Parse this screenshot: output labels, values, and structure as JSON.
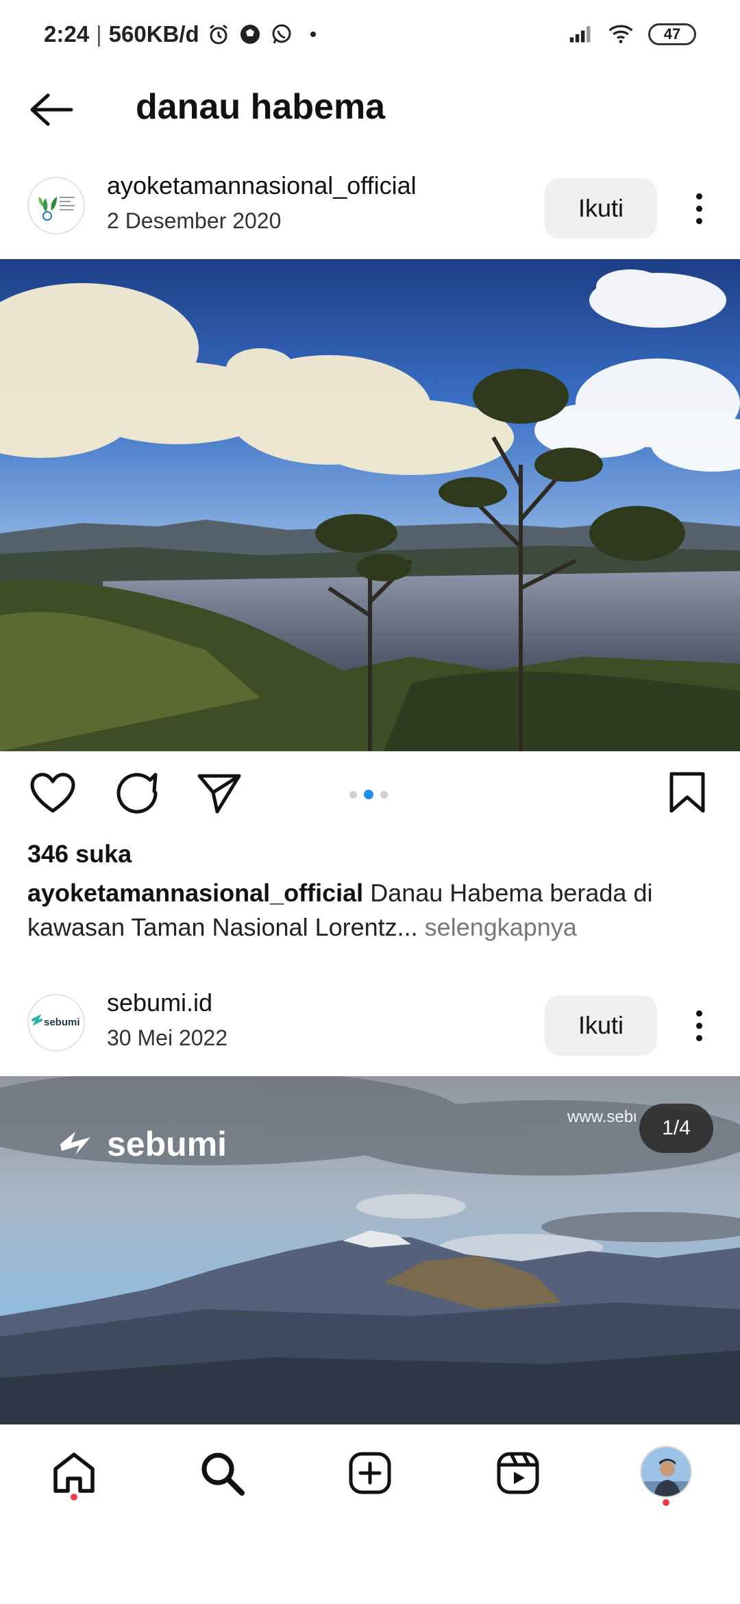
{
  "status_bar": {
    "time": "2:24",
    "separator": "|",
    "network_speed": "560KB/d",
    "battery": "47",
    "icons": [
      "alarm-icon",
      "soccer-ball-icon",
      "whatsapp-icon",
      "dot-icon",
      "signal-icon",
      "wifi-icon",
      "battery-icon"
    ]
  },
  "header": {
    "title": "danau habema",
    "back_icon": "arrow-left-icon"
  },
  "posts": [
    {
      "username": "ayoketamannasional_official",
      "date": "2 Desember 2020",
      "follow_label": "Ikuti",
      "avatar_text": "ayo ke taman nasional",
      "likes": "346 suka",
      "caption_user": "ayoketamannasional_official",
      "caption_text": " Danau Habema berada di kawasan Taman Nasional Lorentz",
      "caption_ellipsis": "...",
      "caption_more": " selengkapnya",
      "carousel_total": 3,
      "carousel_active": 1
    },
    {
      "username": "sebumi.id",
      "date": "30 Mei 2022",
      "follow_label": "Ikuti",
      "avatar_text": "sebumi",
      "page_indicator": "1/4",
      "watermark_logo": "sebumi",
      "watermark_url": "www.sebumi.id"
    }
  ],
  "bottom_nav": {
    "items": [
      "home-icon",
      "search-icon",
      "create-icon",
      "reels-icon",
      "profile-avatar"
    ]
  },
  "colors": {
    "accent_blue": "#1d8ff0",
    "notification_red": "#ed3b4a",
    "button_gray": "#efefef"
  }
}
